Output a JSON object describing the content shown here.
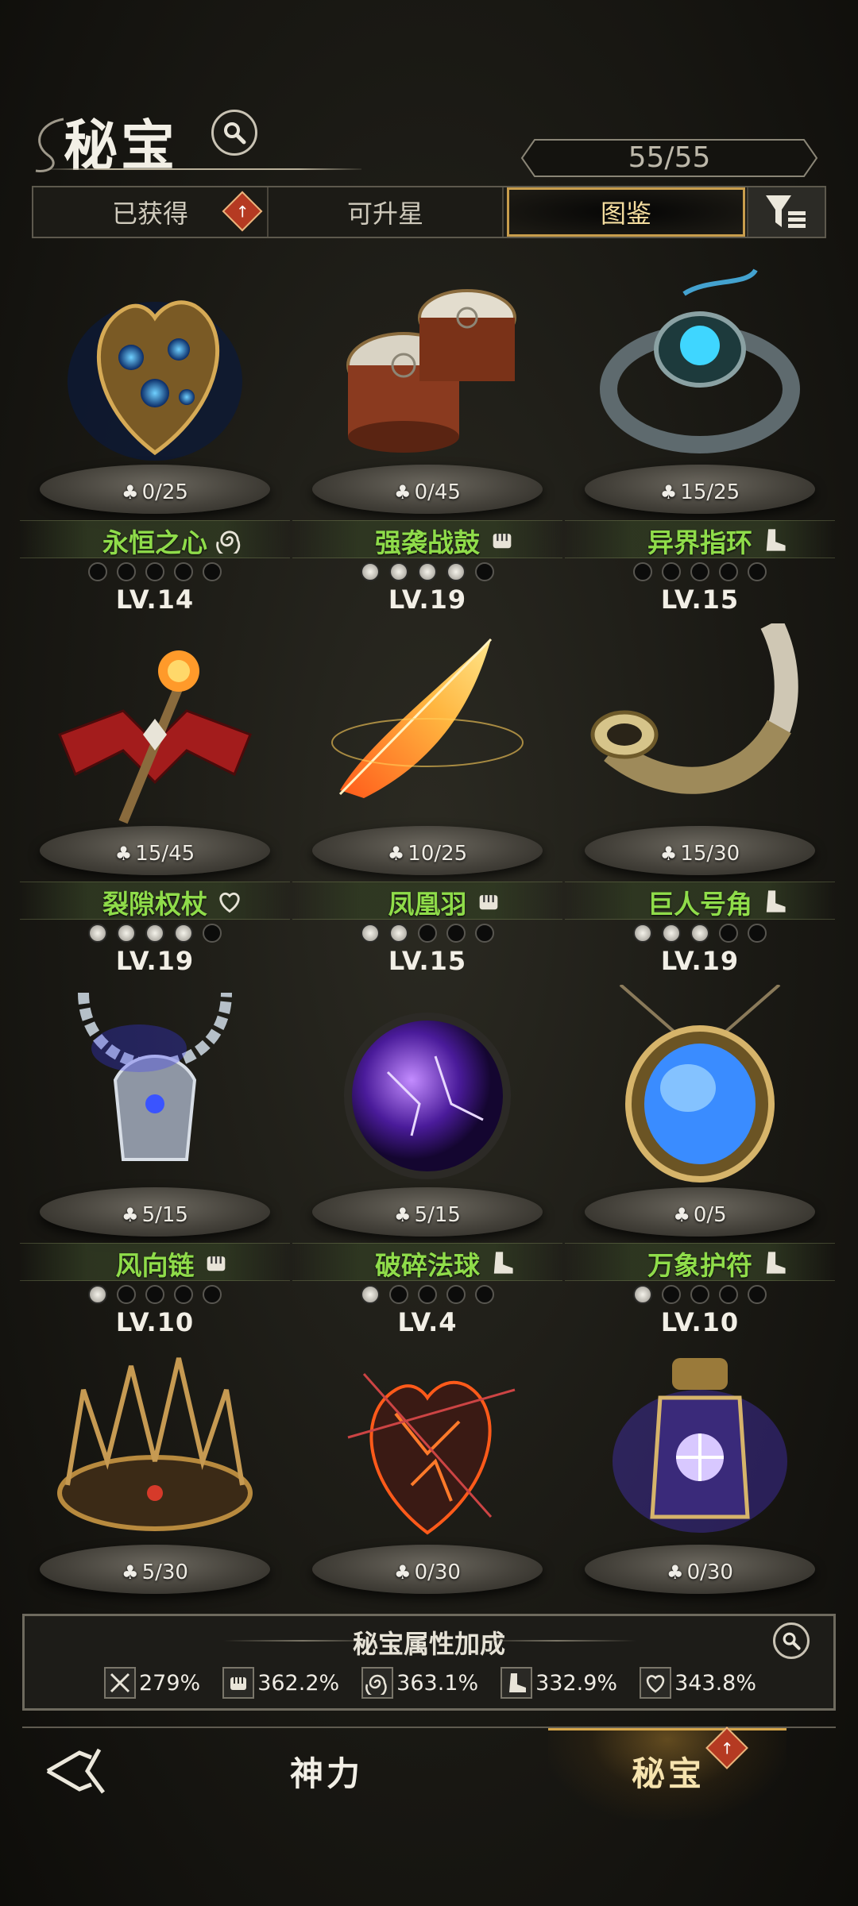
{
  "header": {
    "title": "秘宝",
    "counter": "55/55"
  },
  "tabs": [
    {
      "label": "已获得",
      "badge": true
    },
    {
      "label": "可升星",
      "badge": false
    },
    {
      "label": "图鉴",
      "active": true
    }
  ],
  "items": [
    {
      "name": "永恒之心",
      "progress": "0/25",
      "level": "LV.14",
      "stars": 0,
      "type": "swirl",
      "art": "heart-relic"
    },
    {
      "name": "强袭战鼓",
      "progress": "0/45",
      "level": "LV.19",
      "stars": 4,
      "type": "fist",
      "art": "war-drums"
    },
    {
      "name": "异界指环",
      "progress": "15/25",
      "level": "LV.15",
      "stars": 0,
      "type": "boot",
      "art": "ring"
    },
    {
      "name": "裂隙权杖",
      "progress": "15/45",
      "level": "LV.19",
      "stars": 4,
      "type": "heart",
      "art": "scepter"
    },
    {
      "name": "凤凰羽",
      "progress": "10/25",
      "level": "LV.15",
      "stars": 2,
      "type": "fist",
      "art": "phoenix-feather"
    },
    {
      "name": "巨人号角",
      "progress": "15/30",
      "level": "LV.19",
      "stars": 3,
      "type": "boot",
      "art": "horn"
    },
    {
      "name": "风向链",
      "progress": "5/15",
      "level": "LV.10",
      "stars": 1,
      "type": "fist",
      "art": "necklace"
    },
    {
      "name": "破碎法球",
      "progress": "5/15",
      "level": "LV.4",
      "stars": 1,
      "type": "boot",
      "art": "orb"
    },
    {
      "name": "万象护符",
      "progress": "0/5",
      "level": "LV.10",
      "stars": 1,
      "type": "boot",
      "art": "amulet"
    },
    {
      "name": "",
      "progress": "5/30",
      "level": "",
      "stars": null,
      "type": "",
      "art": "thorn-crown"
    },
    {
      "name": "",
      "progress": "0/30",
      "level": "",
      "stars": null,
      "type": "",
      "art": "burning-heart"
    },
    {
      "name": "",
      "progress": "0/30",
      "level": "",
      "stars": null,
      "type": "",
      "art": "arcane-lantern"
    }
  ],
  "bonus": {
    "title": "秘宝属性加成",
    "stats": [
      {
        "icon": "sword-icon",
        "value": "279%"
      },
      {
        "icon": "fist-icon",
        "value": "362.2%"
      },
      {
        "icon": "swirl-icon",
        "value": "363.1%"
      },
      {
        "icon": "boot-icon",
        "value": "332.9%"
      },
      {
        "icon": "heart-icon",
        "value": "343.8%"
      }
    ]
  },
  "nav": {
    "left_label": "神力",
    "right_label": "秘宝"
  },
  "colors": {
    "name_green": "#8fdc4a",
    "gold_accent": "#c89d4c",
    "badge_red": "#b53a22"
  }
}
